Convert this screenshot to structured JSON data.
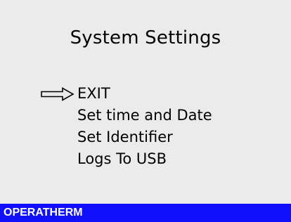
{
  "screen": {
    "title": "System Settings"
  },
  "menu": {
    "selected_index": 0,
    "pointer_icon": "right-arrow-outline-icon",
    "items": [
      {
        "label": "EXIT"
      },
      {
        "label": "Set time and Date"
      },
      {
        "label": "Set Identifier"
      },
      {
        "label": "Logs To USB"
      }
    ]
  },
  "status_bar": {
    "brand": "OPERATHERM",
    "color": "#1010ff"
  }
}
